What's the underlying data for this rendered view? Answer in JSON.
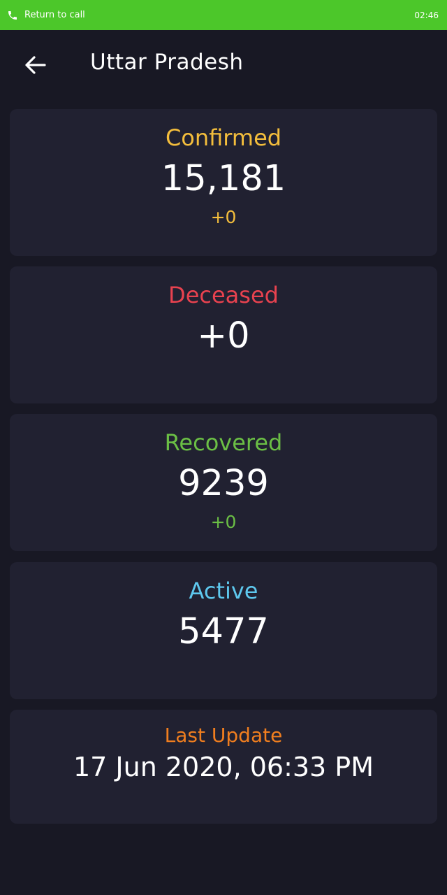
{
  "status_bar": {
    "call_text": "Return to call",
    "time": "02:46",
    "background_color": "#4cc72a"
  },
  "app_bar": {
    "title": "Uttar Pradesh"
  },
  "cards": {
    "confirmed": {
      "label": "Confirmed",
      "value": "15,181",
      "delta": "+0",
      "color": "#f4be3c"
    },
    "deceased": {
      "label": "Deceased",
      "value": "+0",
      "color": "#e8424f"
    },
    "recovered": {
      "label": "Recovered",
      "value": "9239",
      "delta": "+0",
      "color": "#6bbf45"
    },
    "active": {
      "label": "Active",
      "value": "5477",
      "color": "#5ec8ee"
    },
    "last_update": {
      "label": "Last Update",
      "value": "17 Jun 2020, 06:33 PM",
      "color": "#f07e1f"
    }
  }
}
